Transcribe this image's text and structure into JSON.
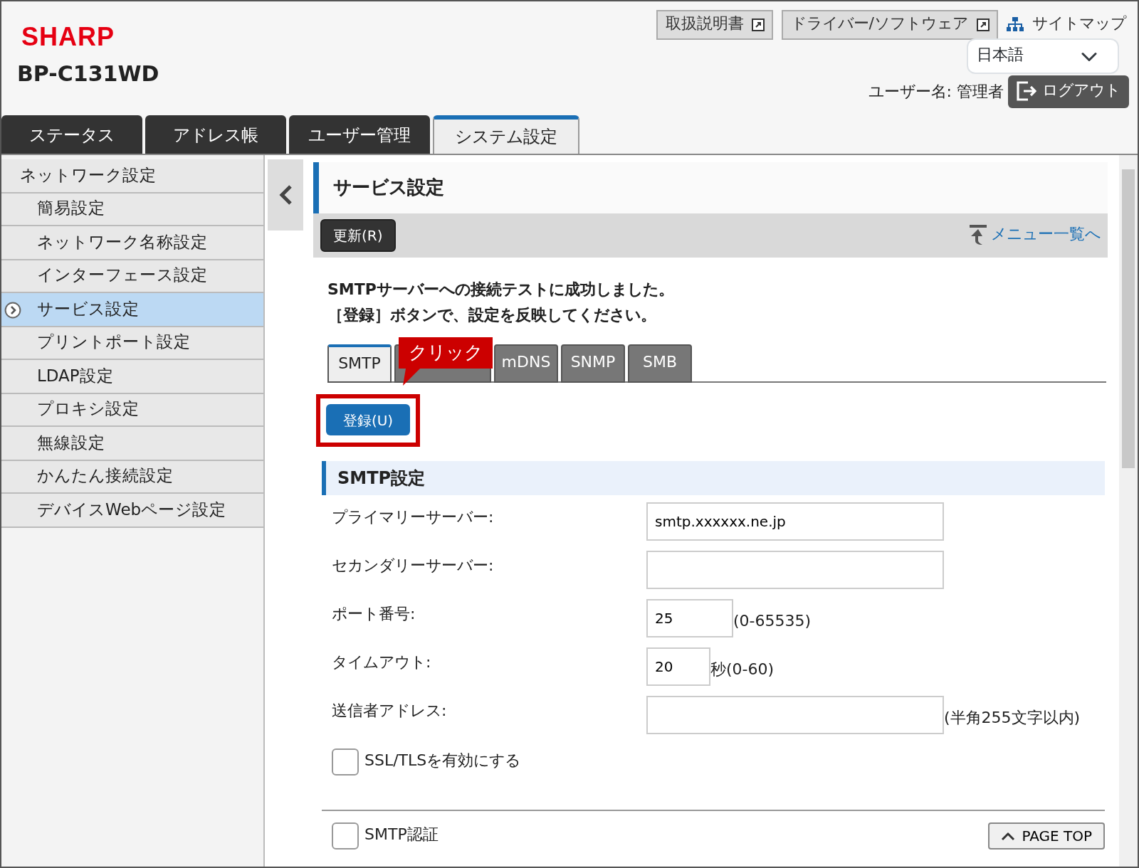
{
  "header": {
    "logo": "SHARP",
    "model": "BP-C131WD",
    "links": [
      {
        "label": "取扱説明書"
      },
      {
        "label": "ドライバー/ソフトウェア"
      }
    ],
    "sitemap": "サイトマップ",
    "language": "日本語",
    "user": "ユーザー名: 管理者",
    "logout": "ログアウト"
  },
  "main_tabs": [
    {
      "label": "ステータス",
      "selected": false
    },
    {
      "label": "アドレス帳",
      "selected": false
    },
    {
      "label": "ユーザー管理",
      "selected": false
    },
    {
      "label": "システム設定",
      "selected": true
    }
  ],
  "sidebar": {
    "group": "ネットワーク設定",
    "items": [
      {
        "label": "簡易設定",
        "selected": false
      },
      {
        "label": "ネットワーク名称設定",
        "selected": false
      },
      {
        "label": "インターフェース設定",
        "selected": false
      },
      {
        "label": "サービス設定",
        "selected": true
      },
      {
        "label": "プリントポート設定",
        "selected": false
      },
      {
        "label": "LDAP設定",
        "selected": false
      },
      {
        "label": "プロキシ設定",
        "selected": false
      },
      {
        "label": "無線設定",
        "selected": false
      },
      {
        "label": "かんたん接続設定",
        "selected": false
      },
      {
        "label": "デバイスWebページ設定",
        "selected": false
      }
    ]
  },
  "page": {
    "title": "サービス設定",
    "refresh": "更新(R)",
    "menu_link": "メニュー一覧へ",
    "message": [
      "SMTPサーバーへの接続テストに成功しました。",
      "［登録］ボタンで、設定を反映してください。"
    ],
    "sub_tabs": [
      {
        "label": "SMTP",
        "selected": true
      },
      {
        "selected": false
      },
      {
        "label": "mDNS",
        "selected": false
      },
      {
        "label": "SNMP",
        "selected": false
      },
      {
        "label": "SMB",
        "selected": false
      }
    ],
    "callout": "クリック",
    "register": "登録(U)",
    "section": "SMTP設定",
    "fields": [
      {
        "label": "プライマリーサーバー:",
        "value": "smtp.xxxxxx.ne.jp",
        "kind": "wide"
      },
      {
        "label": "セカンダリーサーバー:",
        "kind": "wide"
      },
      {
        "label": "ポート番号:",
        "value": "25",
        "hint": "(0-65535)",
        "kind": "short"
      },
      {
        "label": "タイムアウト:",
        "value": "20",
        "hint": "秒(0-60)",
        "kind": "tiny"
      },
      {
        "label": "送信者アドレス:",
        "hint": "(半角255文字以内)",
        "kind": "wide"
      }
    ],
    "ssl": {
      "label": "SSL/TLSを有効にする",
      "checked": false
    },
    "auth": {
      "label": "SMTP認証",
      "checked": false
    },
    "page_top": "PAGE TOP"
  }
}
